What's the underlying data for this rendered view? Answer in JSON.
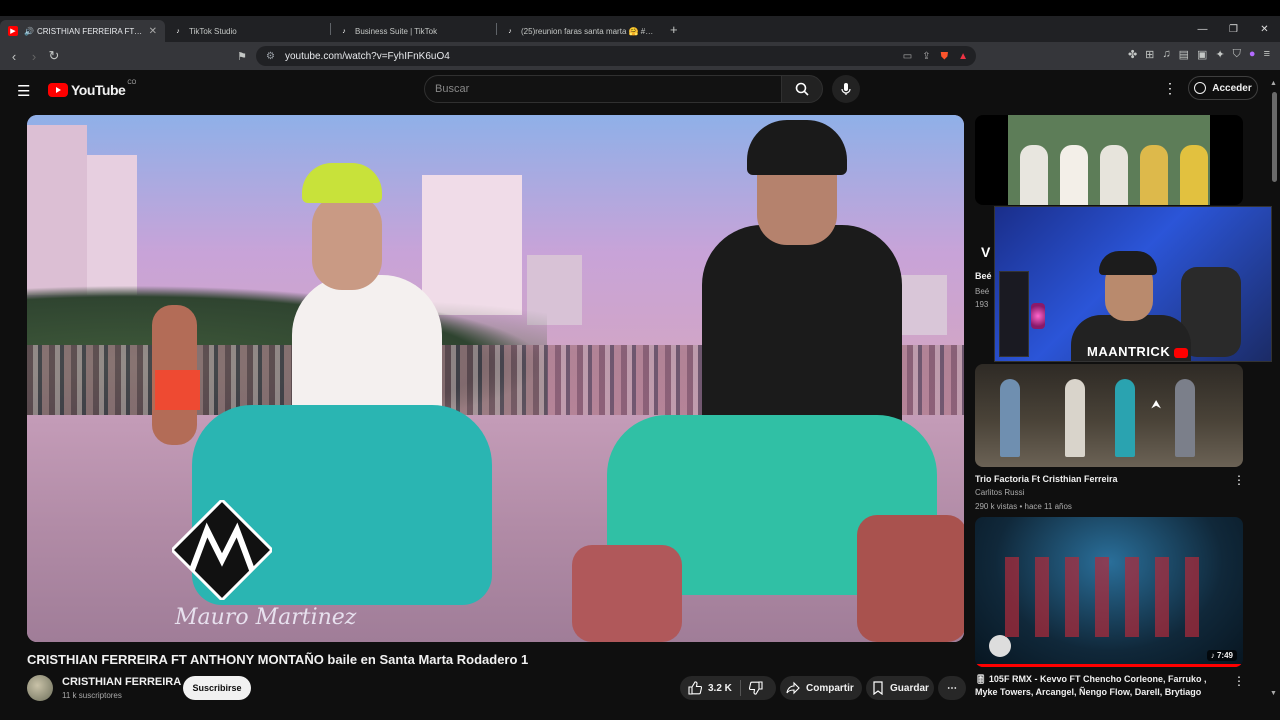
{
  "browser": {
    "tabs": [
      {
        "label": "CRISTHIAN FERREIRA FT ANTHONY MONTAÑO",
        "icon": "youtube-icon",
        "active": true
      },
      {
        "label": "TikTok Studio",
        "icon": "tiktok-icon"
      },
      {
        "label": "Business Suite | TikTok",
        "icon": "tiktok-icon"
      },
      {
        "label": "(25)reunion faras santa marta 🤗 #san...",
        "icon": "tiktok-icon"
      }
    ],
    "url": "youtube.com/watch?v=FyhIFnK6uO4"
  },
  "yt": {
    "logo_text": "YouTube",
    "country": "CO",
    "search_placeholder": "Buscar",
    "signin_label": "Acceder"
  },
  "video": {
    "title": "CRISTHIAN FERREIRA FT ANTHONY MONTAÑO baile en Santa Marta Rodadero 1",
    "watermark": "Mauro Martinez",
    "channel": "CRISTHIAN FERREIRA",
    "subscribers": "11 k suscriptores",
    "subscribe_label": "Suscribirse",
    "likes": "3.2 K",
    "share_label": "Compartir",
    "save_label": "Guardar"
  },
  "sidebar": {
    "partial": {
      "title": "Beé",
      "channel": "Beé",
      "views": "193"
    },
    "streamer_tag": "MAANTRICK",
    "items": [
      {
        "title": "Trio Factoria Ft Cristhian Ferreira",
        "channel": "Carlitos Russi",
        "meta": "290 k vistas • hace 11 años"
      },
      {
        "title": "🎚 105F RMX - Kevvo FT Chencho Corleone, Farruko , Myke Towers, Arcangel, Ñengo Flow, Darell, Brytiago",
        "duration": "7:49",
        "watch_progress": 1.0
      }
    ]
  },
  "colors": {
    "accent": "#ff0000",
    "bg": "#0f0f0f"
  }
}
